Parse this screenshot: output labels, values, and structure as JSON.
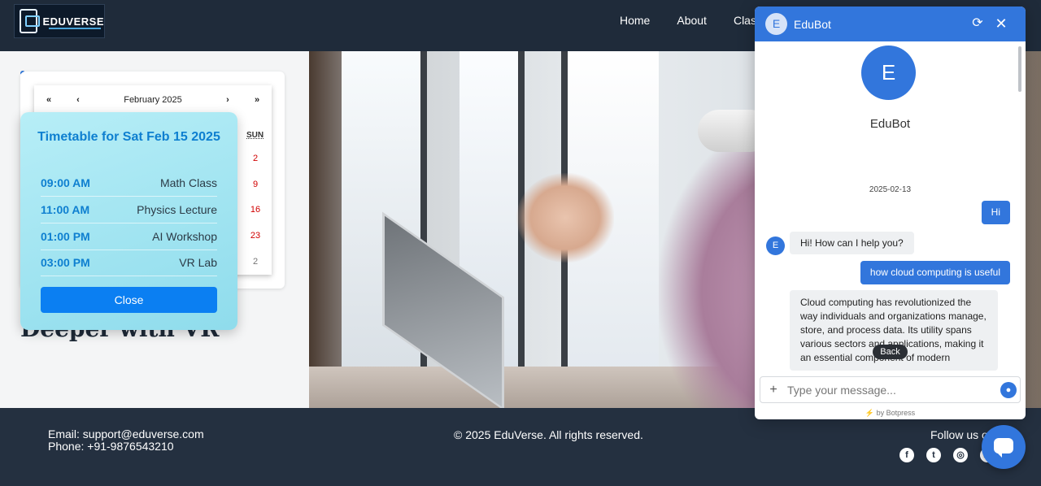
{
  "nav": {
    "logo_text": "EDUVERSE",
    "links": [
      "Home",
      "About",
      "Classes"
    ]
  },
  "hero": {
    "heading": "Deeper with VR"
  },
  "calendar": {
    "prev_year": "«",
    "prev_month": "‹",
    "title": "February 2025",
    "next_month": "›",
    "next_year": "»",
    "weekday": "SUN",
    "days": [
      "2",
      "9",
      "16",
      "23",
      "2"
    ]
  },
  "timetable": {
    "title": "Timetable for Sat Feb 15 2025",
    "rows": [
      {
        "time": "09:00 AM",
        "event": "Math Class"
      },
      {
        "time": "11:00 AM",
        "event": "Physics Lecture"
      },
      {
        "time": "01:00 PM",
        "event": "AI Workshop"
      },
      {
        "time": "03:00 PM",
        "event": "VR Lab"
      }
    ],
    "close_label": "Close"
  },
  "footer": {
    "email": "Email: support@eduverse.com",
    "phone": "Phone: +91-9876543210",
    "copyright": "© 2025 EduVerse. All rights reserved.",
    "follow": "Follow us on",
    "social": [
      "facebook-icon",
      "twitter-icon",
      "instagram-icon",
      "linkedin-icon"
    ]
  },
  "chat": {
    "avatar_letter": "E",
    "bot_name": "EduBot",
    "date": "2025-02-13",
    "messages": [
      {
        "from": "user",
        "text": "Hi"
      },
      {
        "from": "bot",
        "text": "Hi! How can I help you?"
      },
      {
        "from": "user",
        "text": "how cloud computing is useful"
      },
      {
        "from": "bot",
        "text": "Cloud computing has revolutionized the way individuals and organizations manage, store, and process data. Its utility spans various sectors and applications, making it an essential component of modern"
      }
    ],
    "back_label": "Back",
    "input_placeholder": "Type your message...",
    "branding": "by Botpress",
    "accent_color": "#3276dc"
  }
}
